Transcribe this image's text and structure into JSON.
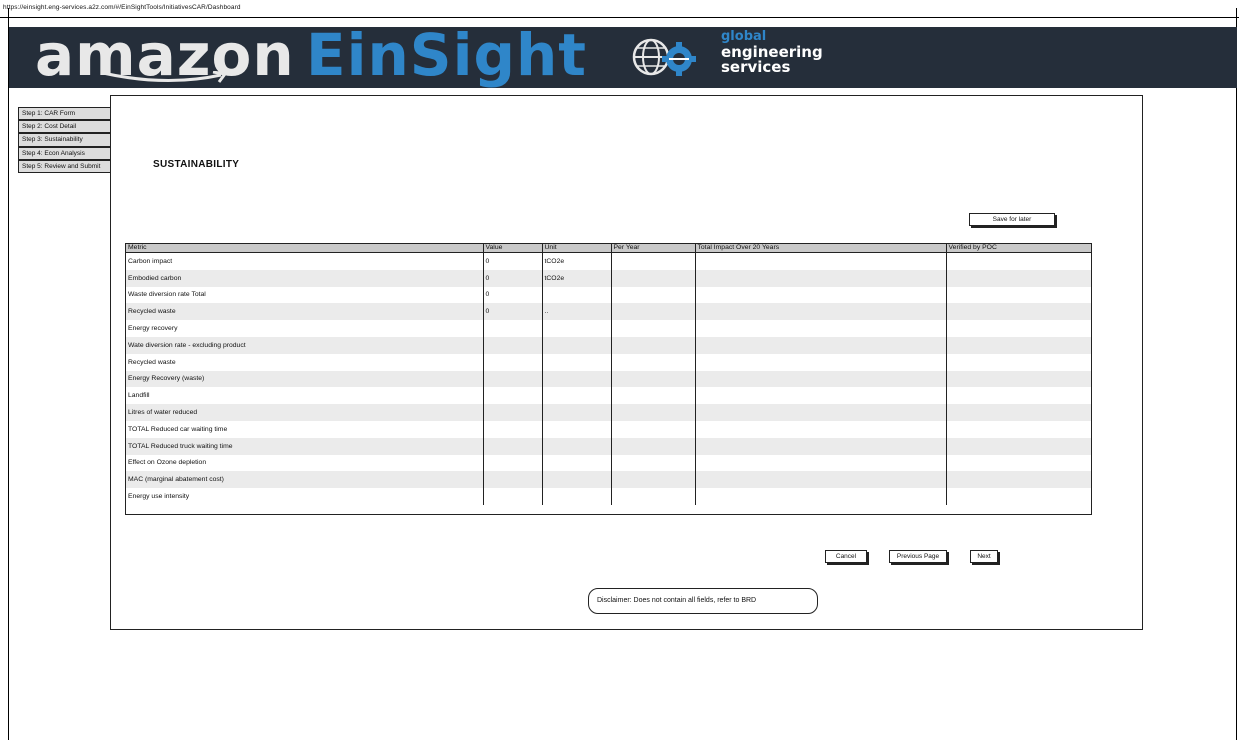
{
  "browser": {
    "url": "https://einsight.eng-services.a2z.com/#/EinSightTools/InitiativesCAR/Dashboard"
  },
  "banner": {
    "brand_primary": "amazon",
    "brand_secondary": "EinSight",
    "tagline_line1": "global",
    "tagline_line2": "engineering",
    "tagline_line3": "services",
    "icon": "globe-gear-icon",
    "colors": {
      "background": "#252e3a",
      "accent": "#2f86c9"
    }
  },
  "steps": [
    {
      "label": "Step 1: CAR Form"
    },
    {
      "label": "Step 2: Cost Detail"
    },
    {
      "label": "Step 3: Sustainability"
    },
    {
      "label": "Step 4: Econ Analysis"
    },
    {
      "label": "Step 5: Review and Submit"
    }
  ],
  "page": {
    "title": "SUSTAINABILITY"
  },
  "toolbar": {
    "save_later": "Save for later"
  },
  "table": {
    "columns": [
      "Metric",
      "Value",
      "Unit",
      "Per Year",
      "Total Impact Over 20 Years",
      "Verified by POC"
    ],
    "rows": [
      [
        "Carbon impact",
        "0",
        "tCO2e",
        "",
        "",
        ""
      ],
      [
        "Embodied carbon",
        "0",
        "tCO2e",
        "",
        "",
        ""
      ],
      [
        "Waste diversion rate  Total",
        "0",
        "",
        "",
        "",
        ""
      ],
      [
        "Recycled waste",
        "0",
        "..",
        "",
        "",
        ""
      ],
      [
        "Energy recovery",
        "",
        "",
        "",
        "",
        ""
      ],
      [
        "Wate diversion rate - excluding product",
        "",
        "",
        "",
        "",
        ""
      ],
      [
        "Recycled waste",
        "",
        "",
        "",
        "",
        ""
      ],
      [
        "Energy Recovery (waste)",
        "",
        "",
        "",
        "",
        ""
      ],
      [
        "Landfill",
        "",
        "",
        "",
        "",
        ""
      ],
      [
        "Litres of water reduced",
        "",
        "",
        "",
        "",
        ""
      ],
      [
        "TOTAL Reduced car waiting time",
        "",
        "",
        "",
        "",
        ""
      ],
      [
        "TOTAL Reduced truck waiting time",
        "",
        "",
        "",
        "",
        ""
      ],
      [
        "Effect on Ozone depletion",
        "",
        "",
        "",
        "",
        ""
      ],
      [
        "MAC (marginal abatement cost)",
        "",
        "",
        "",
        "",
        ""
      ],
      [
        "Energy use intensity",
        "",
        "",
        "",
        "",
        ""
      ]
    ]
  },
  "actions": {
    "cancel": "Cancel",
    "previous": "Previous Page",
    "next": "Next"
  },
  "disclaimer": "Disclaimer: Does not contain all fields, refer to BRD"
}
